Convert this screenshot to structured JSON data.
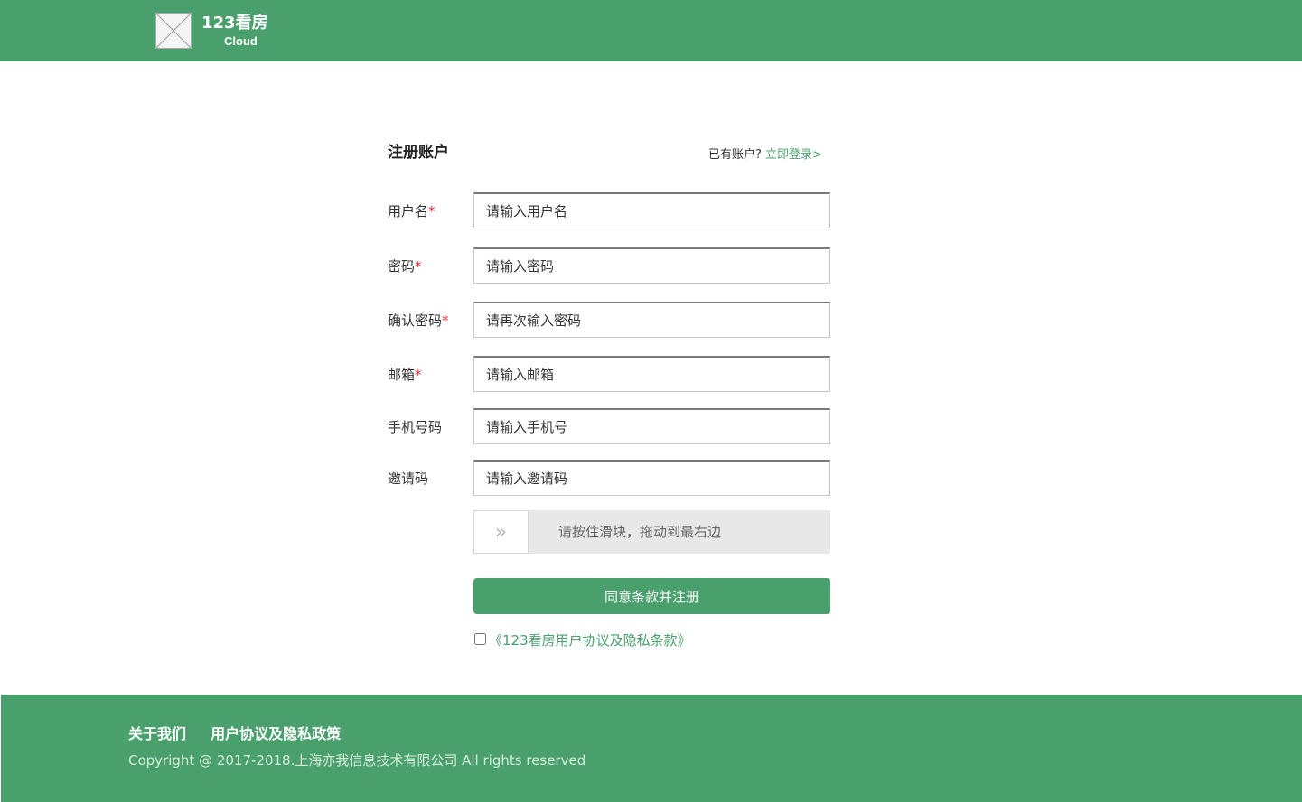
{
  "header": {
    "brand_title": "123看房",
    "brand_subtitle": "Cloud"
  },
  "form": {
    "title": "注册账户",
    "login_prompt": "已有账户?",
    "login_link": "立即登录>",
    "required_mark": "*",
    "fields": [
      {
        "label": "用户名",
        "required": true,
        "placeholder": "请输入用户名",
        "value": ""
      },
      {
        "label": "密码",
        "required": true,
        "placeholder": "请输入密码",
        "value": ""
      },
      {
        "label": "确认密码",
        "required": true,
        "placeholder": "请再次输入密码",
        "value": ""
      },
      {
        "label": "邮箱",
        "required": true,
        "placeholder": "请输入邮箱",
        "value": ""
      },
      {
        "label": "手机号码",
        "required": false,
        "placeholder": "请输入手机号",
        "value": ""
      },
      {
        "label": "邀请码",
        "required": false,
        "placeholder": "请输入邀请码",
        "value": ""
      }
    ],
    "slider": {
      "handle_icon": "»",
      "text": "请按住滑块，拖动到最右边"
    },
    "submit_label": "同意条款并注册",
    "agreement_link": "《123看房用户协议及隐私条款》",
    "agreement_checked": false
  },
  "footer": {
    "links": [
      "关于我们",
      "用户协议及隐私政策"
    ],
    "copyright": "Copyright @ 2017-2018.上海亦我信息技术有限公司 All rights reserved"
  },
  "colors": {
    "brand_green": "#4aa06c",
    "required_red": "#e0202a"
  }
}
